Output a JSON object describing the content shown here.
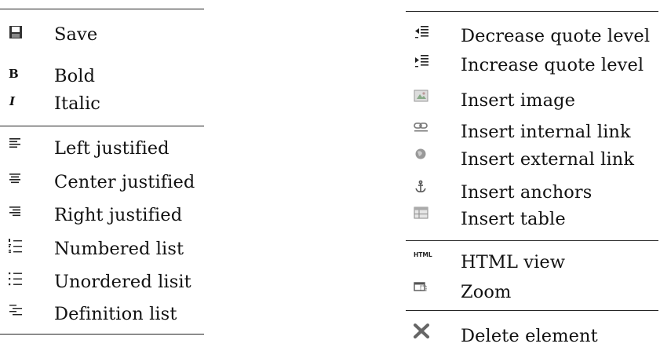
{
  "left_table": {
    "groups": [
      [
        {
          "label": "Save",
          "icon": "save-icon"
        }
      ],
      [
        {
          "label": "Bold",
          "icon": "bold-icon"
        },
        {
          "label": "Italic",
          "icon": "italic-icon"
        }
      ],
      [
        {
          "label": "Left justified",
          "icon": "align-left-icon"
        },
        {
          "label": "Center justified",
          "icon": "align-center-icon"
        },
        {
          "label": "Right justified",
          "icon": "align-right-icon"
        },
        {
          "label": "Numbered list",
          "icon": "numbered-list-icon"
        },
        {
          "label": "Unordered lisit",
          "icon": "unordered-list-icon"
        },
        {
          "label": "Definition list",
          "icon": "definition-list-icon"
        }
      ]
    ]
  },
  "right_table": {
    "groups": [
      [
        {
          "label": "Decrease quote level",
          "icon": "decrease-quote-icon"
        },
        {
          "label": "Increase quote level",
          "icon": "increase-quote-icon"
        },
        {
          "label": "Insert image",
          "icon": "insert-image-icon"
        },
        {
          "label": "Insert internal link",
          "icon": "internal-link-icon"
        },
        {
          "label": "Insert external link",
          "icon": "external-link-icon"
        },
        {
          "label": "Insert anchors",
          "icon": "anchor-icon"
        },
        {
          "label": "Insert table",
          "icon": "table-icon"
        }
      ],
      [
        {
          "label": "HTML view",
          "icon": "html-view-icon",
          "icon_text": "HTML"
        },
        {
          "label": "Zoom",
          "icon": "zoom-icon"
        }
      ],
      [
        {
          "label": "Delete element",
          "icon": "delete-icon"
        }
      ]
    ]
  },
  "colors": {
    "rule": "#222222",
    "text": "#111111",
    "icon_gray": "#777777"
  }
}
